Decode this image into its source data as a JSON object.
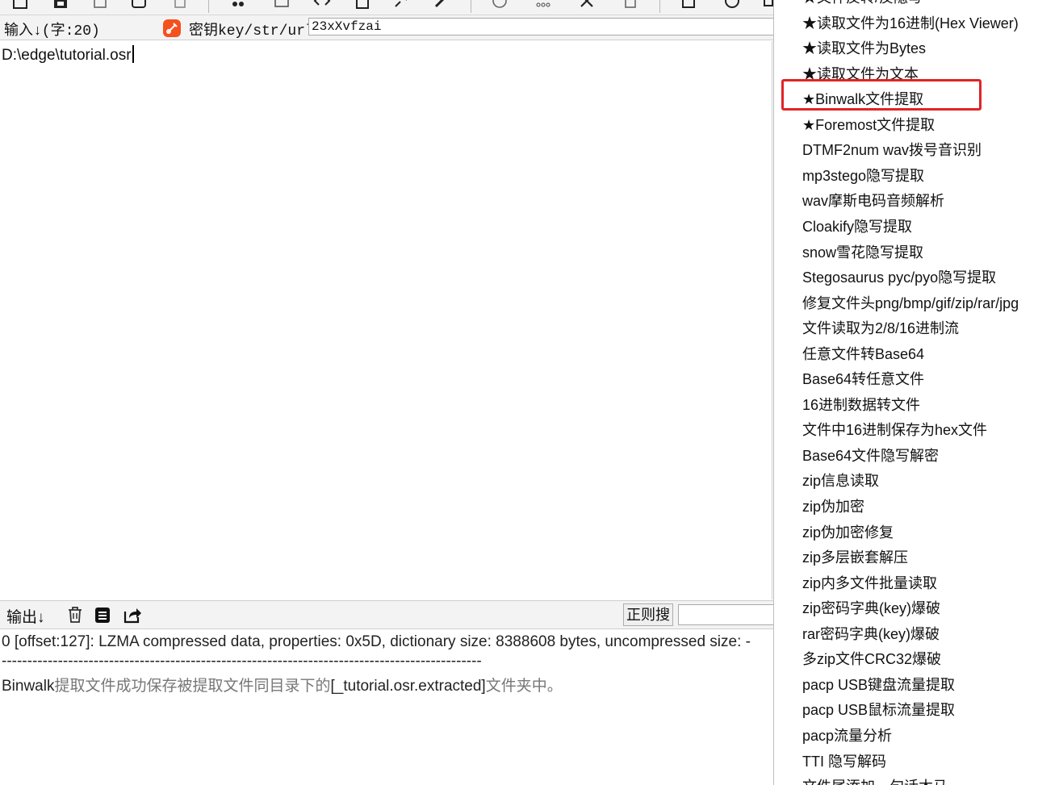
{
  "input_panel": {
    "label": "输入↓(字:20)",
    "key_label": "密钥key/str/url:",
    "key_value": "23xXvfzai",
    "text": "D:\\edge\\tutorial.osr"
  },
  "output_panel": {
    "label": "输出↓",
    "regex_button": "正则搜",
    "lines": [
      "0 [offset:127]: LZMA compressed data, properties: 0x5D, dictionary size: 8388608 bytes, uncompressed size: -",
      "----------------------------------------------------------------------------------------------",
      "提取文件成功保存被提取文件同目录下的",
      "文件夹中。"
    ],
    "line3_prefix": "Binwalk",
    "line3_folder": "[_tutorial.osr.extracted]"
  },
  "menu": {
    "items": [
      "★文件反转/反隐写",
      "★读取文件为16进制(Hex Viewer)",
      "★读取文件为Bytes",
      "★读取文件为文本",
      "★Binwalk文件提取",
      "★Foremost文件提取",
      "DTMF2num  wav拨号音识别",
      "mp3stego隐写提取",
      "wav摩斯电码音频解析",
      "Cloakify隐写提取",
      "snow雪花隐写提取",
      "Stegosaurus pyc/pyo隐写提取",
      "修复文件头png/bmp/gif/zip/rar/jpg",
      "文件读取为2/8/16进制流",
      "任意文件转Base64",
      "Base64转任意文件",
      "16进制数据转文件",
      "文件中16进制保存为hex文件",
      "Base64文件隐写解密",
      "zip信息读取",
      "zip伪加密",
      "zip伪加密修复",
      "zip多层嵌套解压",
      "zip内多文件批量读取",
      "zip密码字典(key)爆破",
      "rar密码字典(key)爆破",
      "多zip文件CRC32爆破",
      "pacp USB键盘流量提取",
      "pacp USB鼠标流量提取",
      "pacp流量分析",
      "TTI 隐写解码",
      "文件尾添加一句话木马"
    ],
    "highlight_color": "#e02424"
  },
  "colors": {
    "panel_bg": "#f3f3f3",
    "key_icon": "#f4511e"
  }
}
